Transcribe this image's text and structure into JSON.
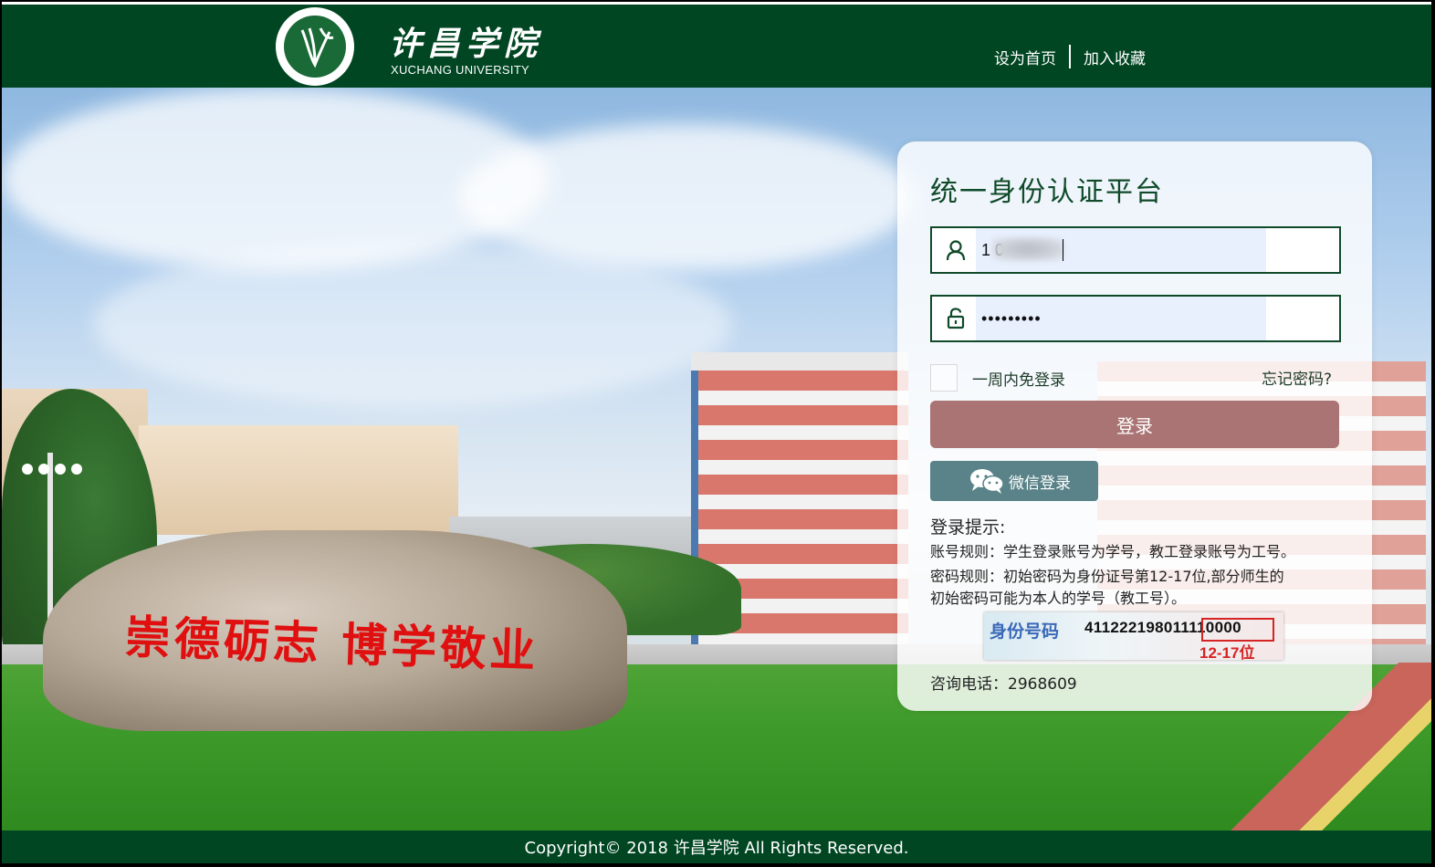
{
  "header": {
    "logo_cn": "许昌学院",
    "logo_en": "XUCHANG UNIVERSITY",
    "nav": [
      "设为首页",
      "加入收藏"
    ]
  },
  "scene": {
    "rock_inscription": "崇德砺志 博学敬业"
  },
  "login": {
    "title": "统一身份认证平台",
    "username_value": "1 0",
    "password_value": "•••••••••",
    "remember_label": "一周内免登录",
    "forgot_label": "忘记密码?",
    "login_button": "登录",
    "wechat_button": "微信登录",
    "tips_title": "登录提示:",
    "tips_account": "账号规则：学生登录账号为学号，教工登录账号为工号。",
    "tips_password_1": "密码规则：初始密码为身份证号第12-17位,部分师生的",
    "tips_password_2": "初始密码可能为本人的学号（教工号）。",
    "id_card": {
      "label": "身份号码",
      "number": "411222198011110000",
      "range": "12-17位"
    },
    "phone": "咨询电话：2968609"
  },
  "footer": {
    "copyright": "Copyright© 2018 许昌学院 All Rights Reserved."
  },
  "colors": {
    "header_green": "#004622",
    "login_button": "#a97473",
    "wechat_button": "#5a8389",
    "title_green": "#0f4a29"
  }
}
